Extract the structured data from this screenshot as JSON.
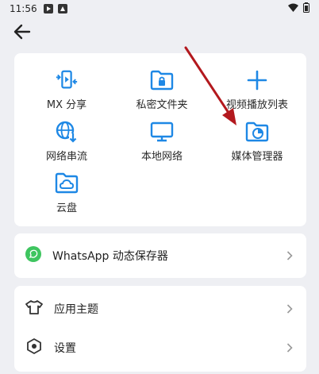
{
  "status_bar": {
    "time": "11:56"
  },
  "grid": {
    "items": [
      {
        "label": "MX 分享",
        "icon": "share-device-icon"
      },
      {
        "label": "私密文件夹",
        "icon": "locked-folder-icon"
      },
      {
        "label": "视频播放列表",
        "icon": "plus-icon"
      },
      {
        "label": "网络串流",
        "icon": "globe-download-icon"
      },
      {
        "label": "本地网络",
        "icon": "monitor-icon"
      },
      {
        "label": "媒体管理器",
        "icon": "folder-chart-icon"
      },
      {
        "label": "云盘",
        "icon": "cloud-folder-icon"
      }
    ]
  },
  "whatsapp": {
    "label": "WhatsApp 动态保存器",
    "icon": "whatsapp-icon"
  },
  "settings_list": {
    "items": [
      {
        "label": "应用主题",
        "icon": "tshirt-icon"
      },
      {
        "label": "设置",
        "icon": "hexagon-settings-icon"
      }
    ]
  },
  "colors": {
    "accent": "#1e88e5",
    "whatsapp_green": "#3ec55f",
    "annotation_arrow": "#b3191e",
    "background": "#eeeff3",
    "card": "#ffffff"
  }
}
